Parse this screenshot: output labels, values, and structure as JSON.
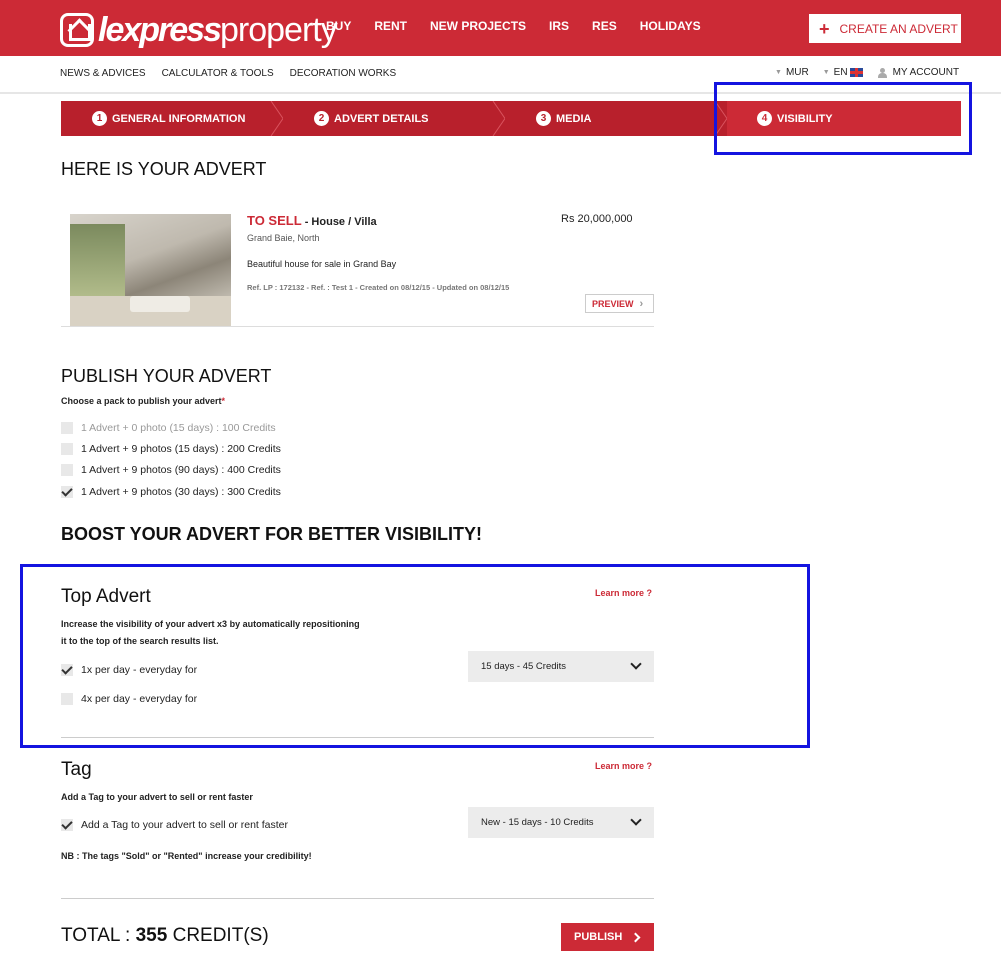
{
  "brand": {
    "logo_bold": "lexpress",
    "logo_light": "property",
    "accent_color": "#cc2a36",
    "highlight_color": "#1414e0"
  },
  "header": {
    "nav": [
      "BUY",
      "RENT",
      "NEW PROJECTS",
      "IRS",
      "RES",
      "HOLIDAYS"
    ],
    "create_advert": "CREATE AN ADVERT",
    "create_advert_icon": "plus-icon"
  },
  "subnav": {
    "links": [
      "NEWS & ADVICES",
      "CALCULATOR & TOOLS",
      "DECORATION WORKS"
    ],
    "currency": "MUR",
    "language": "EN",
    "account": "MY ACCOUNT"
  },
  "steps": [
    {
      "num": "1",
      "label": "GENERAL INFORMATION"
    },
    {
      "num": "2",
      "label": "ADVERT DETAILS"
    },
    {
      "num": "3",
      "label": "MEDIA"
    },
    {
      "num": "4",
      "label": "VISIBILITY"
    }
  ],
  "advert": {
    "heading": "HERE IS YOUR ADVERT",
    "status": "TO SELL",
    "type": " - House / Villa",
    "price": "Rs 20,000,000",
    "location": "Grand Baie, North",
    "description": "Beautiful house for sale in Grand Bay",
    "reference": "Ref. LP : 172132 - Ref. : Test 1 - Created on 08/12/15 - Updated on 08/12/15",
    "preview": "PREVIEW"
  },
  "publish": {
    "heading": "PUBLISH YOUR ADVERT",
    "choose_label": "Choose a pack to publish your advert",
    "required_mark": "*",
    "packs": [
      {
        "label": "1 Advert + 0 photo (15 days) : 100 Credits",
        "checked": false,
        "disabled": true
      },
      {
        "label": "1 Advert + 9 photos (15 days) : 200 Credits",
        "checked": false,
        "disabled": false
      },
      {
        "label": "1 Advert + 9 photos (90 days) : 400 Credits",
        "checked": false,
        "disabled": false
      },
      {
        "label": "1 Advert + 9 photos (30 days) : 300 Credits",
        "checked": true,
        "disabled": false
      }
    ]
  },
  "boost": {
    "heading": "BOOST YOUR ADVERT FOR BETTER VISIBILITY!",
    "top_advert": {
      "title": "Top Advert",
      "learn_more": "Learn more ?",
      "desc_line1": "Increase the visibility of your advert x3 by automatically repositioning",
      "desc_line2": "it to the top of the search results list.",
      "option1": "1x per day - everyday for",
      "option1_checked": true,
      "option2": "4x per day - everyday for",
      "option2_checked": false,
      "select_value": "15 days - 45 Credits"
    },
    "tag": {
      "title": "Tag",
      "learn_more": "Learn more ?",
      "desc": "Add a Tag to your advert to sell or rent faster",
      "option": "Add a Tag to your advert to sell or rent faster",
      "option_checked": true,
      "select_value": "New - 15 days - 10 Credits",
      "nb": "NB : The tags \"Sold\" or \"Rented\" increase your credibility!"
    }
  },
  "footer": {
    "total_label": "TOTAL : ",
    "total_value": "355",
    "total_unit": " CREDIT(S)",
    "publish": "PUBLISH"
  }
}
